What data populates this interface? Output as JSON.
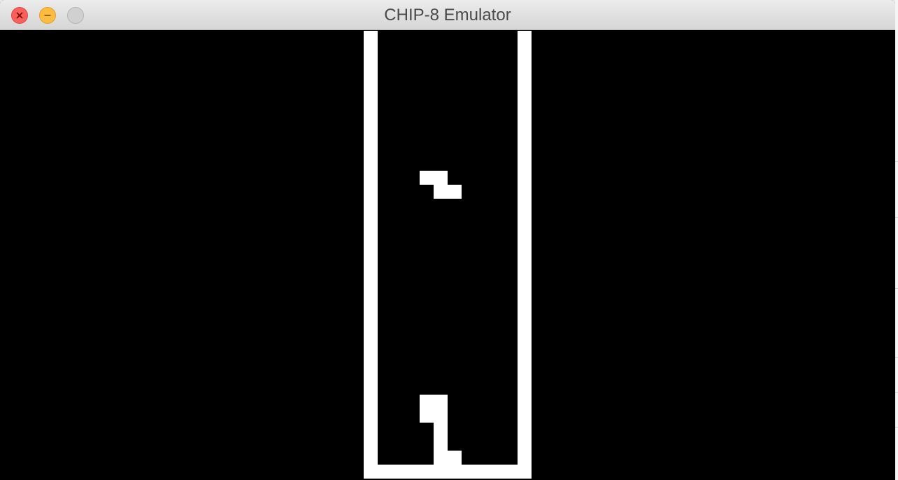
{
  "window": {
    "title": "CHIP-8 Emulator",
    "buttons": {
      "close": "close-icon",
      "minimize": "minimize-icon",
      "zoom": "zoom-icon"
    }
  },
  "display": {
    "resolution": "64x32",
    "foreground": "#ffffff",
    "background": "#000000"
  },
  "colors": {
    "close": "#fc605c",
    "minimize": "#fdbc40",
    "zoom_disabled": "#d0d0d0"
  }
}
